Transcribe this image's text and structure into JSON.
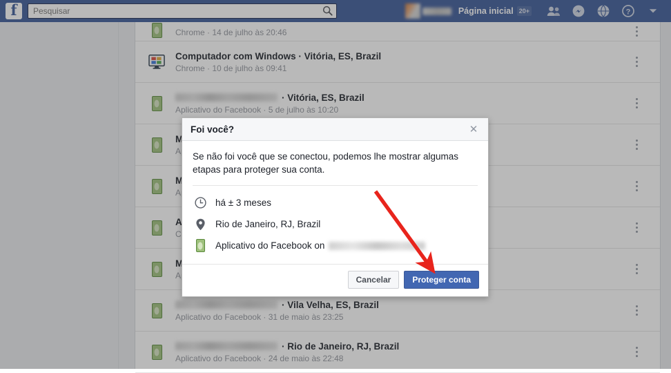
{
  "header": {
    "logo": "f",
    "search": {
      "placeholder": "Pesquisar",
      "value": ""
    },
    "search_icon": "search-icon",
    "home_label": "Página inicial",
    "home_badge": "20+",
    "icons": [
      "friends-icon",
      "messenger-icon",
      "globe-icon",
      "help-icon",
      "account-dropdown-icon"
    ]
  },
  "sessions": [
    {
      "icon": "phone-icon",
      "title": "",
      "title_blurred": true,
      "blur_width": 0,
      "subtitle": "Chrome · 14 de julho às 20:46",
      "partial": true
    },
    {
      "icon": "windows-computer-icon",
      "title": "Computador com Windows · Vitória, ES, Brazil",
      "title_blurred": false,
      "subtitle": "Chrome · 10 de julho às 09:41"
    },
    {
      "icon": "phone-icon",
      "title": "· Vitória, ES, Brazil",
      "title_blurred": true,
      "blur_width": 148,
      "subtitle": "Aplicativo do Facebook · 5 de julho às 10:20"
    },
    {
      "icon": "phone-icon",
      "title": "M",
      "title_blurred": false,
      "subtitle": "Ap"
    },
    {
      "icon": "phone-icon",
      "title": "M",
      "title_blurred": false,
      "subtitle": "Ap"
    },
    {
      "icon": "phone-icon",
      "title": "A",
      "title_blurred": false,
      "subtitle": "Ch"
    },
    {
      "icon": "phone-icon",
      "title": "M",
      "title_blurred": false,
      "subtitle": "Ap"
    },
    {
      "icon": "phone-icon",
      "title": "· Vila Velha, ES, Brazil",
      "title_blurred": true,
      "blur_width": 148,
      "subtitle": "Aplicativo do Facebook · 31 de maio às 23:25"
    },
    {
      "icon": "phone-icon",
      "title": "· Rio de Janeiro, RJ, Brazil",
      "title_blurred": true,
      "blur_width": 148,
      "subtitle": "Aplicativo do Facebook · 24 de maio às 22:48",
      "partial_bottom": true
    }
  ],
  "dialog": {
    "title": "Foi você?",
    "close_icon": "close-icon",
    "description": "Se não foi você que se conectou, podemos lhe mostrar algumas etapas para proteger sua conta.",
    "details": [
      {
        "icon": "clock-icon",
        "text": "há ± 3 meses",
        "blurred_suffix": false
      },
      {
        "icon": "location-pin-icon",
        "text": "Rio de Janeiro, RJ, Brazil",
        "blurred_suffix": false
      },
      {
        "icon": "phone-icon",
        "text": "Aplicativo do Facebook on",
        "blurred_suffix": true
      }
    ],
    "cancel_label": "Cancelar",
    "protect_label": "Proteger conta"
  },
  "annotation": {
    "type": "red-arrow",
    "color": "#e8241c",
    "points_to": "Proteger conta"
  },
  "colors": {
    "facebook_blue": "#3b5998",
    "button_blue": "#4267b2",
    "page_bg": "#e9ebee",
    "arrow_red": "#e8241c"
  }
}
